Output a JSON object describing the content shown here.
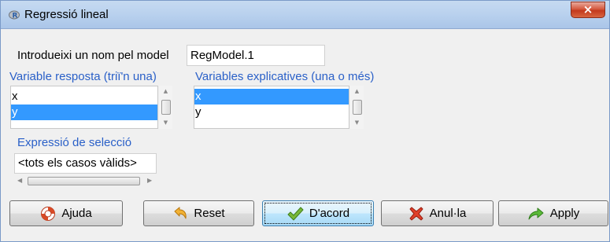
{
  "window": {
    "title": "Regressió lineal",
    "close_label": "×"
  },
  "model_name": {
    "label": "Introdueixi un nom pel model",
    "value": "RegModel.1"
  },
  "response_list": {
    "label": "Variable resposta (triï'n una)",
    "items": [
      "x",
      "y"
    ],
    "selected_index": 1
  },
  "explanatory_list": {
    "label": "Variables explicatives (una o més)",
    "items": [
      "x",
      "y"
    ],
    "selected_index": 0
  },
  "selection_expression": {
    "label": "Expressió de selecció",
    "value": "<tots els casos vàlids>"
  },
  "buttons": {
    "help": "Ajuda",
    "reset": "Reset",
    "ok": "D'acord",
    "cancel": "Anul·la",
    "apply": "Apply"
  },
  "colors": {
    "label_blue": "#2a60c8",
    "selection": "#3399ff",
    "titlebar": "#b9d1ee"
  },
  "icons": {
    "title": "r-logo-icon",
    "help": "lifebuoy-icon",
    "reset": "undo-arrow-icon",
    "ok": "checkmark-icon",
    "cancel": "red-x-icon",
    "apply": "green-arrow-icon"
  }
}
